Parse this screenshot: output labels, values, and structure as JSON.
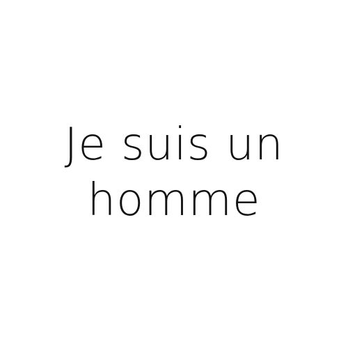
{
  "caption": {
    "line_1": "Je suis un",
    "line_2": "homme"
  },
  "colors": {
    "background": "#ffffff",
    "text": "#111111"
  }
}
